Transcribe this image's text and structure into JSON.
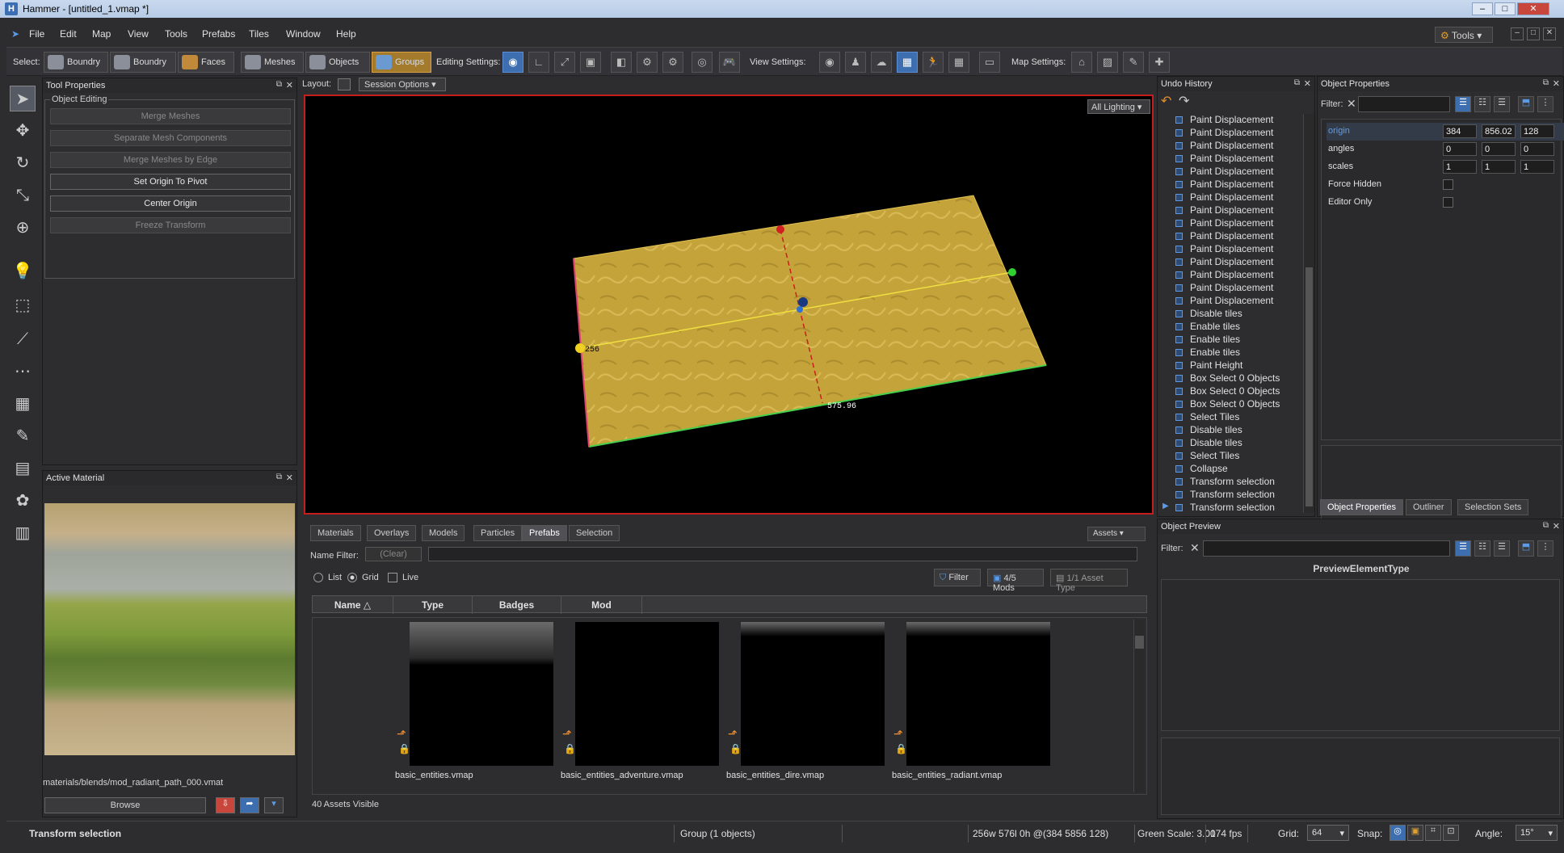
{
  "window": {
    "title": "Hammer - [untitled_1.vmap *]"
  },
  "menu": [
    "File",
    "Edit",
    "Map",
    "View",
    "Tools",
    "Prefabs",
    "Tiles",
    "Window",
    "Help"
  ],
  "tools_button": "Tools",
  "toolbar": {
    "select_label": "Select:",
    "select_modes": [
      "Boundry",
      "Boundry",
      "Faces",
      "Meshes",
      "Objects",
      "Groups"
    ],
    "editing_label": "Editing Settings:",
    "view_label": "View Settings:",
    "map_label": "Map Settings:"
  },
  "tool_properties": {
    "title": "Tool Properties",
    "group_title": "Object Editing",
    "buttons": [
      "Merge Meshes",
      "Separate Mesh Components",
      "Merge Meshes by Edge",
      "Set Origin To Pivot",
      "Center Origin",
      "Freeze Transform"
    ]
  },
  "active_material": {
    "title": "Active Material",
    "path": "materials/blends/mod_radiant_path_000.vmat",
    "browse_label": "Browse"
  },
  "viewport": {
    "layout_label": "Layout:",
    "session_options": "Session Options",
    "lighting": "All Lighting",
    "dim_width": "256",
    "dim_length": "575.96"
  },
  "undo_history": {
    "title": "Undo History",
    "items": [
      "Paint Displacement",
      "Paint Displacement",
      "Paint Displacement",
      "Paint Displacement",
      "Paint Displacement",
      "Paint Displacement",
      "Paint Displacement",
      "Paint Displacement",
      "Paint Displacement",
      "Paint Displacement",
      "Paint Displacement",
      "Paint Displacement",
      "Paint Displacement",
      "Paint Displacement",
      "Paint Displacement",
      "Disable tiles",
      "Enable tiles",
      "Enable tiles",
      "Enable tiles",
      "Paint Height",
      "Box Select 0 Objects",
      "Box Select 0 Objects",
      "Box Select 0 Objects",
      "Select Tiles",
      "Disable tiles",
      "Disable tiles",
      "Select Tiles",
      "Collapse",
      "Transform selection",
      "Transform selection",
      "Transform selection"
    ]
  },
  "object_properties": {
    "title": "Object Properties",
    "filter_label": "Filter:",
    "rows": [
      {
        "label": "origin",
        "values": [
          "384",
          "856.02",
          "128"
        ]
      },
      {
        "label": "angles",
        "values": [
          "0",
          "0",
          "0"
        ]
      },
      {
        "label": "scales",
        "values": [
          "1",
          "1",
          "1"
        ]
      },
      {
        "label": "Force Hidden"
      },
      {
        "label": "Editor Only"
      }
    ],
    "tabs": [
      "Object Properties",
      "Outliner",
      "Selection Sets"
    ]
  },
  "object_preview": {
    "title": "Object Preview",
    "filter_label": "Filter:",
    "element_type": "PreviewElementType"
  },
  "asset_browser": {
    "tabs": [
      "Materials",
      "Overlays",
      "Models",
      "Particles",
      "Prefabs",
      "Selection"
    ],
    "assets_button": "Assets",
    "name_filter_label": "Name Filter:",
    "clear_label": "(Clear)",
    "view_list": "List",
    "view_grid": "Grid",
    "live_label": "Live",
    "filter_button": "Filter",
    "mods_button": "4/5 Mods",
    "asset_type_button": "1/1 Asset Type",
    "columns": [
      "Name",
      "Type",
      "Badges",
      "Mod"
    ],
    "items": [
      "basic_entities.vmap",
      "basic_entities_adventure.vmap",
      "basic_entities_dire.vmap",
      "basic_entities_radiant.vmap"
    ],
    "visible_count": "40 Assets Visible"
  },
  "status": {
    "action": "Transform selection",
    "group": "Group (1 objects)",
    "dims": "256w 576l 0h @(384 5856 128)",
    "green_scale": "Green Scale: 3.00",
    "fps": "174 fps",
    "grid_label": "Grid:",
    "grid_value": "64",
    "snap_label": "Snap:",
    "angle_label": "Angle:",
    "angle_value": "15°"
  },
  "colors": {
    "accent": "#3d6fb0",
    "selection": "#c41e1e",
    "group_active": "#a47a2c"
  }
}
